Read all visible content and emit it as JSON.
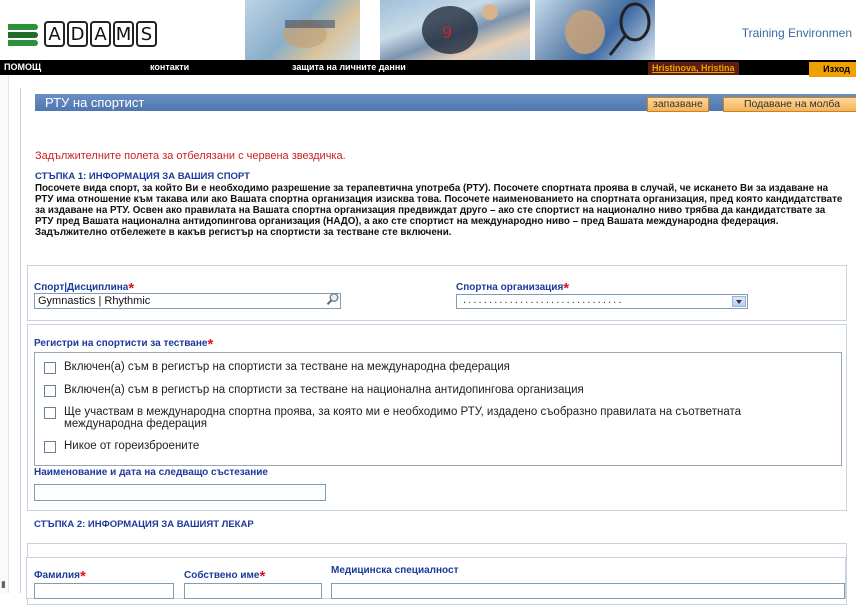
{
  "header": {
    "logo_letters": [
      "A",
      "D",
      "A",
      "M",
      "S"
    ],
    "environment": "Training Environmen"
  },
  "topbar": {
    "help": "ПОМОЩ",
    "contacts": "контакти",
    "privacy": "защита на личните данни",
    "user": "Hristinova, Hristina",
    "exit": "Изход"
  },
  "form": {
    "title": "РТУ на спортист",
    "save_label": "запазване",
    "submit_label": "Подаване на молба",
    "required_note": "Задължителните полета за отбелязани с червена звездичка.",
    "step1": {
      "title": "СТЪПКА 1: ИНФОРМАЦИЯ ЗА ВАШИЯ СПОРТ",
      "body": "Посочете вида спорт, за който Ви е необходимо разрешение за терапевтична употреба (РТУ). Посочете спортната проява в случай, че искането Ви за издаване на РТУ има отношение към такава или ако Вашата спортна организация изисква това. Посочете наименованието на спортната организация, пред която кандидатствате за издаване на РТУ. Освен ако правилата на Вашата спортна организация предвиждат друго – ако сте спортист на национално ниво трябва да кандидатствате за РТУ пред Вашата национална антидопингова организация (НАДО), а ако сте спортист на международно ниво – пред Вашата международна федерация. Задължително отбележете в какъв регистър на спортисти за тестване сте включени."
    },
    "sport": {
      "label": "Спорт|Дисциплина",
      "required_mark": "*",
      "value": "Gymnastics | Rhythmic"
    },
    "organization": {
      "label": "Спортна организация",
      "required_mark": "*",
      "selected": "..............................."
    },
    "registers": {
      "label": "Регистри на спортисти за тестване",
      "required_mark": "*",
      "options": [
        "Включен(а) съм в регистър на спортисти за тестване на международна федерация",
        "Включен(а) съм в регистър на спортисти за тестване на национална антидопингова организация",
        "Ще участвам в международна спортна проява, за която ми е необходимо РТУ, издадено съобразно правилата на съответната международна федерация",
        "Никое от гореизброените"
      ]
    },
    "next_competition": {
      "label": "Наименование и дата на следващо състезание",
      "value": ""
    },
    "step2": {
      "title": "СТЪПКА 2: ИНФОРМАЦИЯ ЗА ВАШИЯТ ЛЕКАР",
      "surname_label": "Фамилия",
      "firstname_label": "Собствено име",
      "specialty_label": "Медицинска специалност",
      "required_mark": "*"
    }
  },
  "colors": {
    "title_bar": "#5a80b8",
    "label_blue": "#1b3a9a",
    "required_red": "#e0141b",
    "button_orange": "#f4b35a",
    "topbar_black": "#000000"
  }
}
